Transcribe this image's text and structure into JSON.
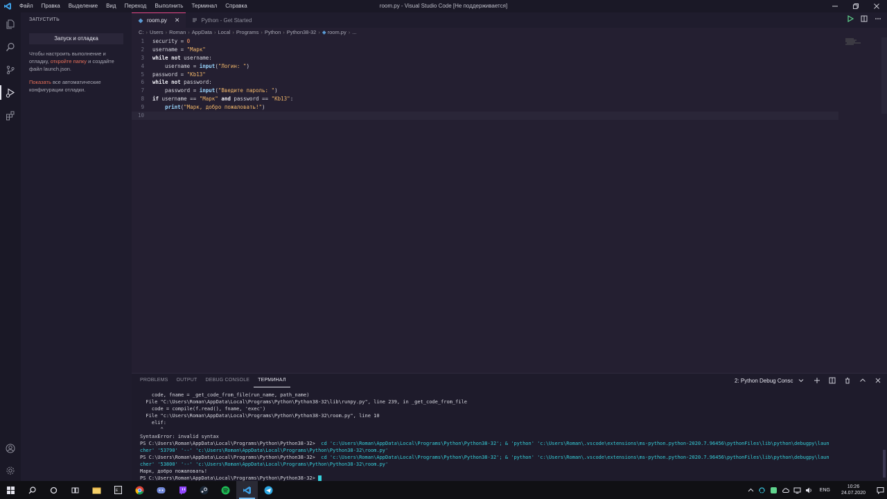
{
  "titlebar": {
    "menu": [
      "Файл",
      "Правка",
      "Выделение",
      "Вид",
      "Переход",
      "Выполнить",
      "Терминал",
      "Справка"
    ],
    "title": "room.py - Visual Studio Code [Не поддерживается]"
  },
  "sidebar": {
    "title": "ЗАПУСТИТЬ",
    "button": "Запуск и отладка",
    "text1_a": "Чтобы настроить выполнение и отладку, ",
    "text1_link": "откройте папку",
    "text1_b": " и создайте файл launch.json.",
    "text2_link": "Показать",
    "text2_b": " все автоматические конфигурации отладки."
  },
  "tabs": [
    {
      "label": "room.py",
      "icon": "python-file-icon"
    },
    {
      "label": "Python - Get Started",
      "icon": "preview-icon"
    }
  ],
  "breadcrumb": [
    "C:",
    "Users",
    "Roman",
    "AppData",
    "Local",
    "Programs",
    "Python",
    "Python38-32",
    "room.py",
    "..."
  ],
  "code": {
    "line_numbers": [
      "1",
      "2",
      "3",
      "4",
      "5",
      "6",
      "7",
      "8",
      "9",
      "10"
    ]
  },
  "panel": {
    "tabs": [
      "PROBLEMS",
      "OUTPUT",
      "DEBUG CONSOLE",
      "ТЕРМИНАЛ"
    ],
    "terminal_select": "2: Python Debug Consc",
    "terminal_lines": [
      "    code, fname = _get_code_from_file(run_name, path_name)",
      "  File \"C:\\Users\\Roman\\AppData\\Local\\Programs\\Python\\Python38-32\\lib\\runpy.py\", line 239, in _get_code_from_file",
      "    code = compile(f.read(), fname, 'exec')",
      "  File \"c:\\Users\\Roman\\AppData\\Local\\Programs\\Python\\Python38-32\\room.py\", line 10",
      "    elif:",
      "       ^",
      "SyntaxError: invalid syntax"
    ],
    "prompt": "PS C:\\Users\\Roman\\AppData\\Local\\Programs\\Python\\Python38-32> ",
    "cmd1a": " cd 'c:\\Users\\Roman\\AppData\\Local\\Programs\\Python\\Python38-32'; & 'python' 'c:\\Users\\Roman\\.vscode\\extensions\\ms-python.python-2020.7.96456\\pythonFiles\\lib\\python\\debugpy\\laun",
    "cmd1b": "cher' '53790' '--' 'c:\\Users\\Roman\\AppData\\Local\\Programs\\Python\\Python38-32\\room.py'",
    "cmd2a": " cd 'c:\\Users\\Roman\\AppData\\Local\\Programs\\Python\\Python38-32'; & 'python' 'c:\\Users\\Roman\\.vscode\\extensions\\ms-python.python-2020.7.96456\\pythonFiles\\lib\\python\\debugpy\\laun",
    "cmd2b": "cher' '53800' '--' 'c:\\Users\\Roman\\AppData\\Local\\Programs\\Python\\Python38-32\\room.py'",
    "output": "Марк, добро пожаловать!"
  },
  "taskbar": {
    "lang": "ENG",
    "time": "10:26",
    "date": "24.07.2020"
  },
  "colors": {
    "accent": "#e94b8a",
    "terminal_cyan": "#36d1dc",
    "link": "#e8705a"
  }
}
